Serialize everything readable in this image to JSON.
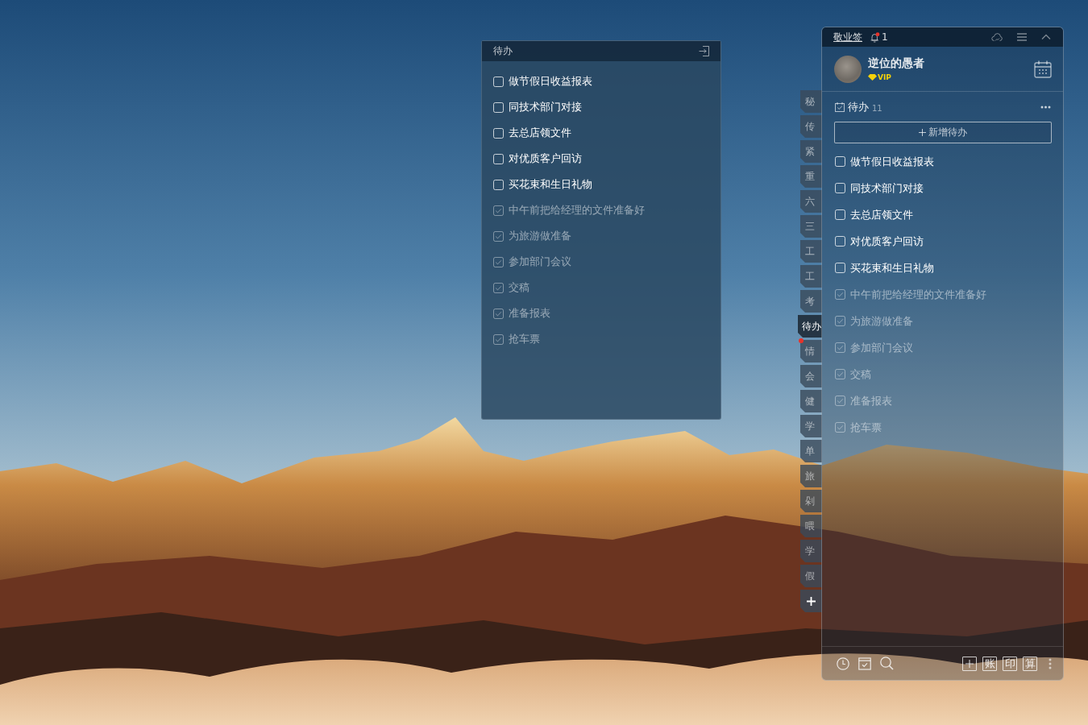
{
  "desktop_note": {
    "title": "待办",
    "items": [
      {
        "text": "做节假日收益报表",
        "checked": false
      },
      {
        "text": "同技术部门对接",
        "checked": false
      },
      {
        "text": "去总店领文件",
        "checked": false
      },
      {
        "text": "对优质客户回访",
        "checked": false
      },
      {
        "text": "买花束和生日礼物",
        "checked": false
      },
      {
        "text": "中午前把给经理的文件准备好",
        "checked": true
      },
      {
        "text": "为旅游做准备",
        "checked": true
      },
      {
        "text": "参加部门会议",
        "checked": true
      },
      {
        "text": "交稿",
        "checked": true
      },
      {
        "text": "准备报表",
        "checked": true
      },
      {
        "text": "抢车票",
        "checked": true
      }
    ]
  },
  "category_tabs": [
    {
      "label": "秘",
      "selected": false,
      "unread": false
    },
    {
      "label": "传",
      "selected": false,
      "unread": false
    },
    {
      "label": "紧",
      "selected": false,
      "unread": false
    },
    {
      "label": "重",
      "selected": false,
      "unread": false
    },
    {
      "label": "六",
      "selected": false,
      "unread": false
    },
    {
      "label": "三",
      "selected": false,
      "unread": false
    },
    {
      "label": "工",
      "selected": false,
      "unread": false
    },
    {
      "label": "工",
      "selected": false,
      "unread": false
    },
    {
      "label": "考",
      "selected": false,
      "unread": false
    },
    {
      "label": "待办",
      "selected": true,
      "unread": false
    },
    {
      "label": "情",
      "selected": false,
      "unread": true
    },
    {
      "label": "会",
      "selected": false,
      "unread": false
    },
    {
      "label": "健",
      "selected": false,
      "unread": false
    },
    {
      "label": "学",
      "selected": false,
      "unread": false
    },
    {
      "label": "单",
      "selected": false,
      "unread": false
    },
    {
      "label": "旅",
      "selected": false,
      "unread": false
    },
    {
      "label": "剁",
      "selected": false,
      "unread": false
    },
    {
      "label": "喂",
      "selected": false,
      "unread": false
    },
    {
      "label": "学",
      "selected": false,
      "unread": false
    },
    {
      "label": "假",
      "selected": false,
      "unread": false
    }
  ],
  "app_panel": {
    "app_name": "敬业签",
    "notification_count": "1",
    "user": {
      "name": "逆位的愚者",
      "badge": "VIP"
    },
    "section": {
      "title": "待办",
      "count": "11",
      "add_button": "新增待办",
      "items": [
        {
          "text": "做节假日收益报表",
          "checked": false
        },
        {
          "text": "同技术部门对接",
          "checked": false
        },
        {
          "text": "去总店领文件",
          "checked": false
        },
        {
          "text": "对优质客户回访",
          "checked": false
        },
        {
          "text": "买花束和生日礼物",
          "checked": false
        },
        {
          "text": "中午前把给经理的文件准备好",
          "checked": true
        },
        {
          "text": "为旅游做准备",
          "checked": true
        },
        {
          "text": "参加部门会议",
          "checked": true
        },
        {
          "text": "交稿",
          "checked": true
        },
        {
          "text": "准备报表",
          "checked": true
        },
        {
          "text": "抢车票",
          "checked": true
        }
      ]
    },
    "quick_tools": [
      "账",
      "印",
      "算"
    ]
  }
}
